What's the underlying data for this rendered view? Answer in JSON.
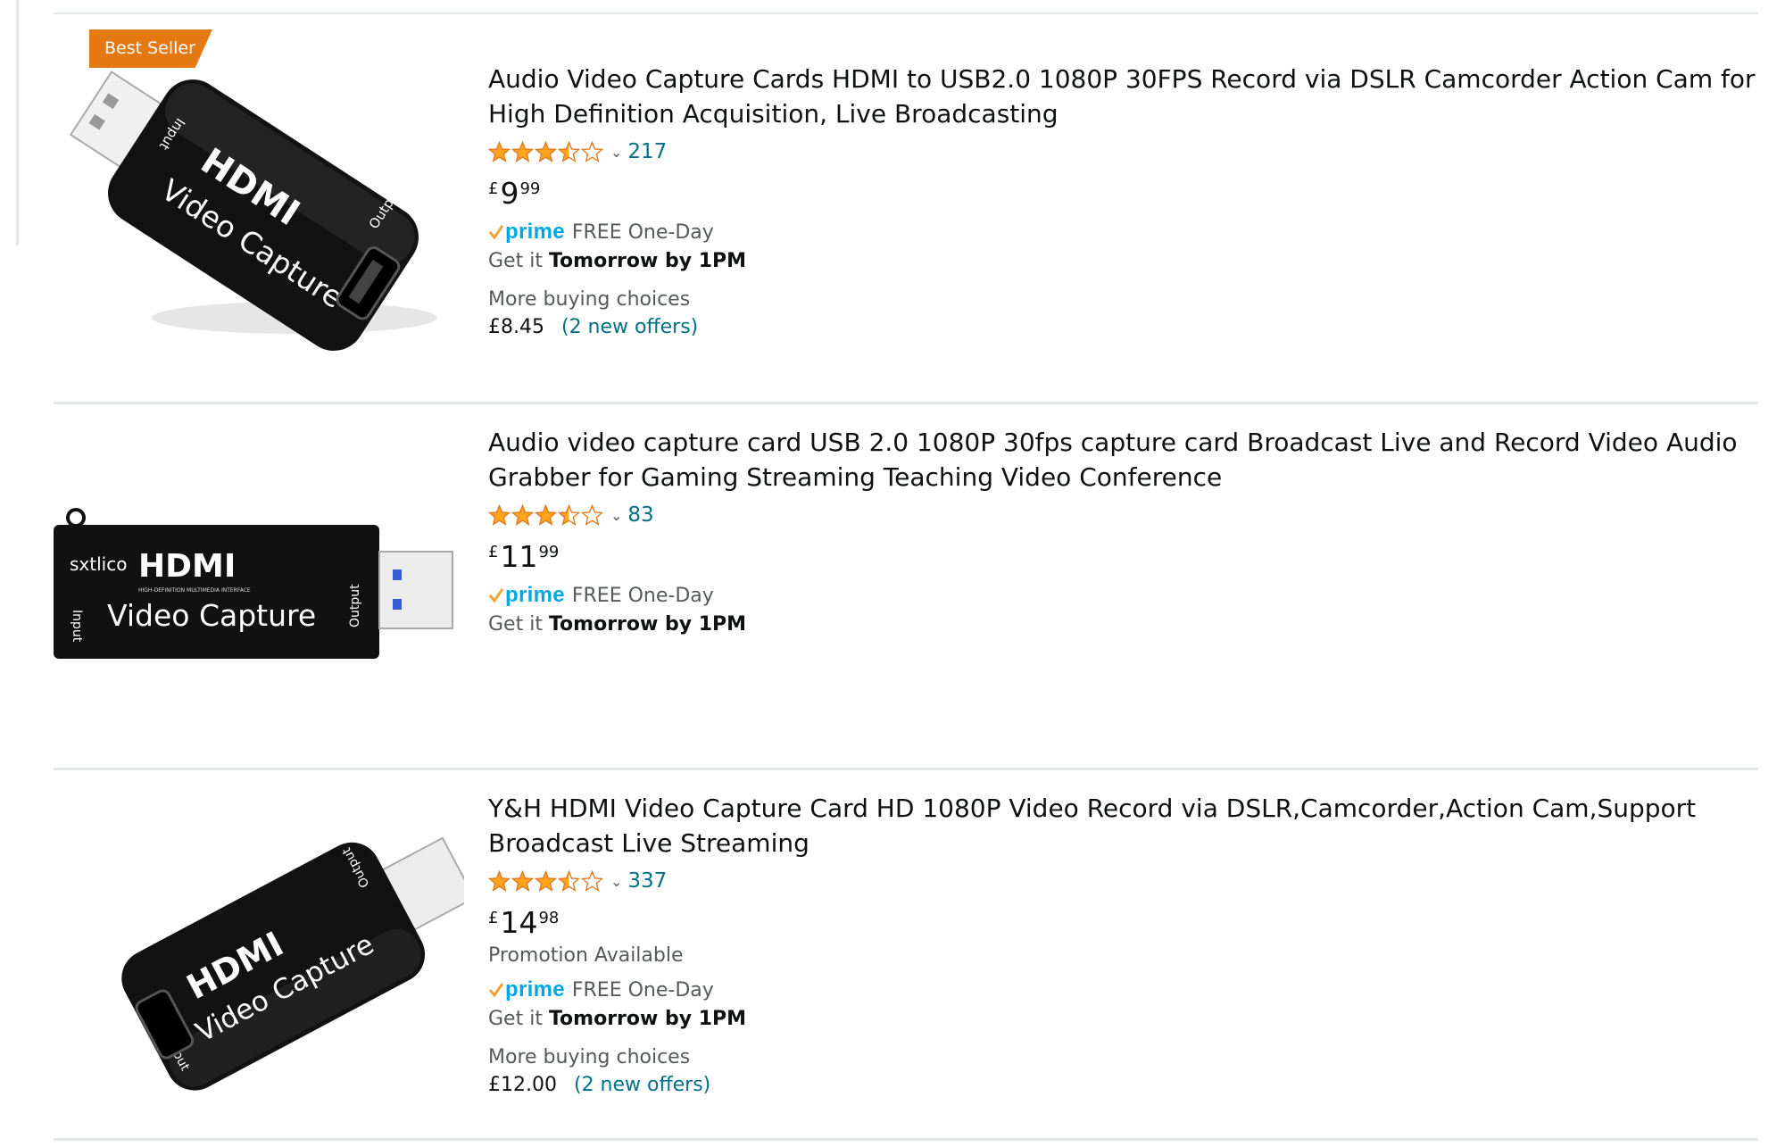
{
  "results": [
    {
      "badge": "Best Seller",
      "title": "Audio Video Capture Cards HDMI to USB2.0 1080P 30FPS Record via DSLR Camcorder Action Cam for High Definition Acquisition, Live Broadcasting",
      "rating": 3.5,
      "review_count": "217",
      "price": {
        "currency": "£",
        "whole": "9",
        "fraction": "99"
      },
      "prime_label": "prime",
      "delivery_type": "FREE One-Day",
      "delivery_prefix": "Get it",
      "delivery_when": "Tomorrow by 1PM",
      "more_choices": "More buying choices",
      "offer_price": "£8.45",
      "offer_link": "(2 new offers)",
      "image_text": {
        "port_a": "Input",
        "logo": "HDMI",
        "product": "Video Capture",
        "port_b": "Output"
      }
    },
    {
      "title": "Audio video capture card USB 2.0 1080P 30fps capture card Broadcast Live and Record Video Audio Grabber for Gaming Streaming Teaching Video Conference",
      "rating": 3.5,
      "review_count": "83",
      "price": {
        "currency": "£",
        "whole": "11",
        "fraction": "99"
      },
      "prime_label": "prime",
      "delivery_type": "FREE One-Day",
      "delivery_prefix": "Get it",
      "delivery_when": "Tomorrow by 1PM",
      "image_text": {
        "brand": "sxtlico",
        "logo": "HDMI",
        "sub": "HIGH-DEFINITION MULTIMEDIA INTERFACE",
        "product": "Video Capture",
        "port_a": "Input",
        "port_b": "Output"
      }
    },
    {
      "title": "Y&H HDMI Video Capture Card HD 1080P Video Record via DSLR,Camcorder,Action Cam,Support Broadcast Live Streaming",
      "rating": 3.5,
      "review_count": "337",
      "price": {
        "currency": "£",
        "whole": "14",
        "fraction": "98"
      },
      "promotion": "Promotion Available",
      "prime_label": "prime",
      "delivery_type": "FREE One-Day",
      "delivery_prefix": "Get it",
      "delivery_when": "Tomorrow by 1PM",
      "more_choices": "More buying choices",
      "offer_price": "£12.00",
      "offer_link": "(2 new offers)",
      "image_text": {
        "port_a": "Input",
        "logo": "HDMI",
        "product": "Video Capture",
        "port_b": "Output"
      }
    }
  ],
  "colors": {
    "badge": "#e47911",
    "link": "#007185",
    "star": "#ffa41c",
    "prime": "#00a8e1",
    "check": "#f0a33a"
  },
  "icons": {
    "star": "star-icon",
    "chevron": "chevron-down-icon",
    "check": "prime-check-icon"
  }
}
